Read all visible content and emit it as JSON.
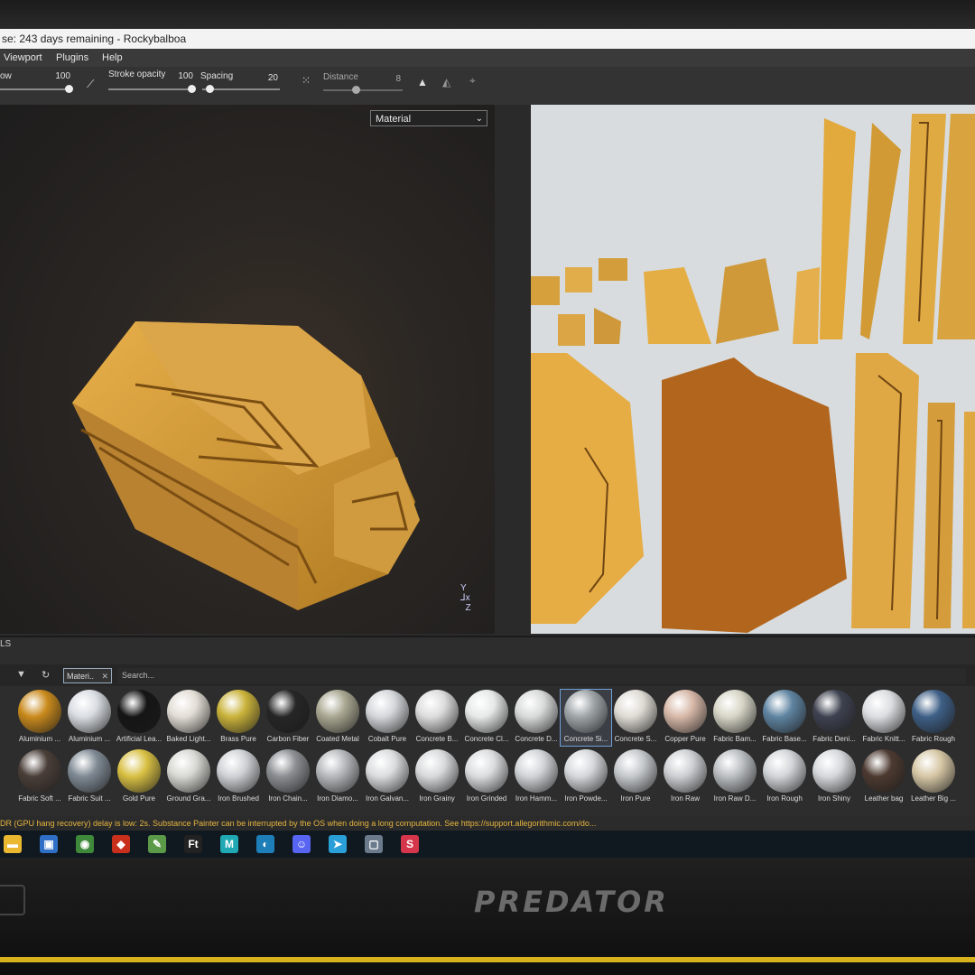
{
  "window": {
    "title": "se: 243 days remaining - Rockybalboa"
  },
  "menu": [
    "Viewport",
    "Plugins",
    "Help"
  ],
  "toolbar": {
    "flow_label": "ow",
    "flow_value": "100",
    "stroke_opacity_label": "Stroke opacity",
    "stroke_opacity_value": "100",
    "spacing_label": "Spacing",
    "spacing_value": "20",
    "distance_label": "Distance",
    "distance_value": "8"
  },
  "viewport": {
    "channel_select": "Material"
  },
  "shelf": {
    "tab_label": "LS",
    "filter_chip": "Materi..",
    "search_placeholder": "Search...",
    "row1": [
      {
        "label": "Aluminium ...",
        "color": "#c98a1c"
      },
      {
        "label": "Aluminium ...",
        "color": "#d9dde2"
      },
      {
        "label": "Artificial Lea...",
        "color": "#151515"
      },
      {
        "label": "Baked Light...",
        "color": "#e2ddd5"
      },
      {
        "label": "Brass Pure",
        "color": "#c9b23a"
      },
      {
        "label": "Carbon Fiber",
        "color": "#262626"
      },
      {
        "label": "Coated Metal",
        "color": "#a9a791"
      },
      {
        "label": "Cobalt Pure",
        "color": "#d4d7da"
      },
      {
        "label": "Concrete B...",
        "color": "#dcdcdc"
      },
      {
        "label": "Concrete Cl...",
        "color": "#e6e8e8"
      },
      {
        "label": "Concrete D...",
        "color": "#d8d9d9"
      },
      {
        "label": "Concrete Si...",
        "color": "#9fa5a8"
      },
      {
        "label": "Concrete S...",
        "color": "#dedbd4"
      },
      {
        "label": "Copper Pure",
        "color": "#d7b8a8"
      },
      {
        "label": "Fabric Bam...",
        "color": "#d6d5c6"
      },
      {
        "label": "Fabric Base...",
        "color": "#5f84a1"
      },
      {
        "label": "Fabric Deni...",
        "color": "#3e4250"
      },
      {
        "label": "Fabric Knitt...",
        "color": "#dcdde0"
      },
      {
        "label": "Fabric Rough",
        "color": "#3e5f86"
      }
    ],
    "row2": [
      {
        "label": "Fabric Soft ...",
        "color": "#4a3e38"
      },
      {
        "label": "Fabric Suit ...",
        "color": "#7f8a94"
      },
      {
        "label": "Gold Pure",
        "color": "#d8c043"
      },
      {
        "label": "Ground Gra...",
        "color": "#d8d8d3"
      },
      {
        "label": "Iron Brushed",
        "color": "#cfd2d5"
      },
      {
        "label": "Iron Chain...",
        "color": "#8b8e92"
      },
      {
        "label": "Iron Diamo...",
        "color": "#b6b9bc"
      },
      {
        "label": "Iron Galvan...",
        "color": "#dadcde"
      },
      {
        "label": "Iron Grainy",
        "color": "#d7d9db"
      },
      {
        "label": "Iron Grinded",
        "color": "#dadcde"
      },
      {
        "label": "Iron Hamm...",
        "color": "#d1d4d7"
      },
      {
        "label": "Iron Powde...",
        "color": "#d5d8db"
      },
      {
        "label": "Iron Pure",
        "color": "#c5c9cc"
      },
      {
        "label": "Iron Raw",
        "color": "#cdd0d3"
      },
      {
        "label": "Iron Raw D...",
        "color": "#bbbfc2"
      },
      {
        "label": "Iron Rough",
        "color": "#d2d5d8"
      },
      {
        "label": "Iron Shiny",
        "color": "#d6d9dc"
      },
      {
        "label": "Leather bag",
        "color": "#4c3a30"
      },
      {
        "label": "Leather Big ...",
        "color": "#d6c7a5"
      }
    ]
  },
  "status": {
    "message": "DR (GPU hang recovery) delay is low: 2s. Substance Painter can be interrupted by the OS when doing a long computation. See https://support.allegorithmic.com/do..."
  },
  "taskbar": {
    "icons": [
      {
        "name": "file-explorer-icon",
        "color": "#e9b830",
        "glyph": "▬"
      },
      {
        "name": "store-icon",
        "color": "#2f6fc6",
        "glyph": "▣"
      },
      {
        "name": "chrome-icon",
        "color": "#3e8a3a",
        "glyph": "◉"
      },
      {
        "name": "red-app-icon",
        "color": "#c9301c",
        "glyph": "◆"
      },
      {
        "name": "notepad-icon",
        "color": "#5a9a48",
        "glyph": "✎"
      },
      {
        "name": "ft-app-icon",
        "color": "#222",
        "glyph": "Ft"
      },
      {
        "name": "maya-icon",
        "color": "#20a9b5",
        "glyph": "M"
      },
      {
        "name": "blue-app-icon",
        "color": "#1e7fb8",
        "glyph": "◐"
      },
      {
        "name": "discord-icon",
        "color": "#5865f2",
        "glyph": "☺"
      },
      {
        "name": "telegram-icon",
        "color": "#2a9fd8",
        "glyph": "➤"
      },
      {
        "name": "vm-app-icon",
        "color": "#6b7b8c",
        "glyph": "▢"
      },
      {
        "name": "substance-painter-icon",
        "color": "#d6364b",
        "glyph": "S"
      }
    ]
  },
  "laptop": {
    "brand": "PREDATOR"
  }
}
